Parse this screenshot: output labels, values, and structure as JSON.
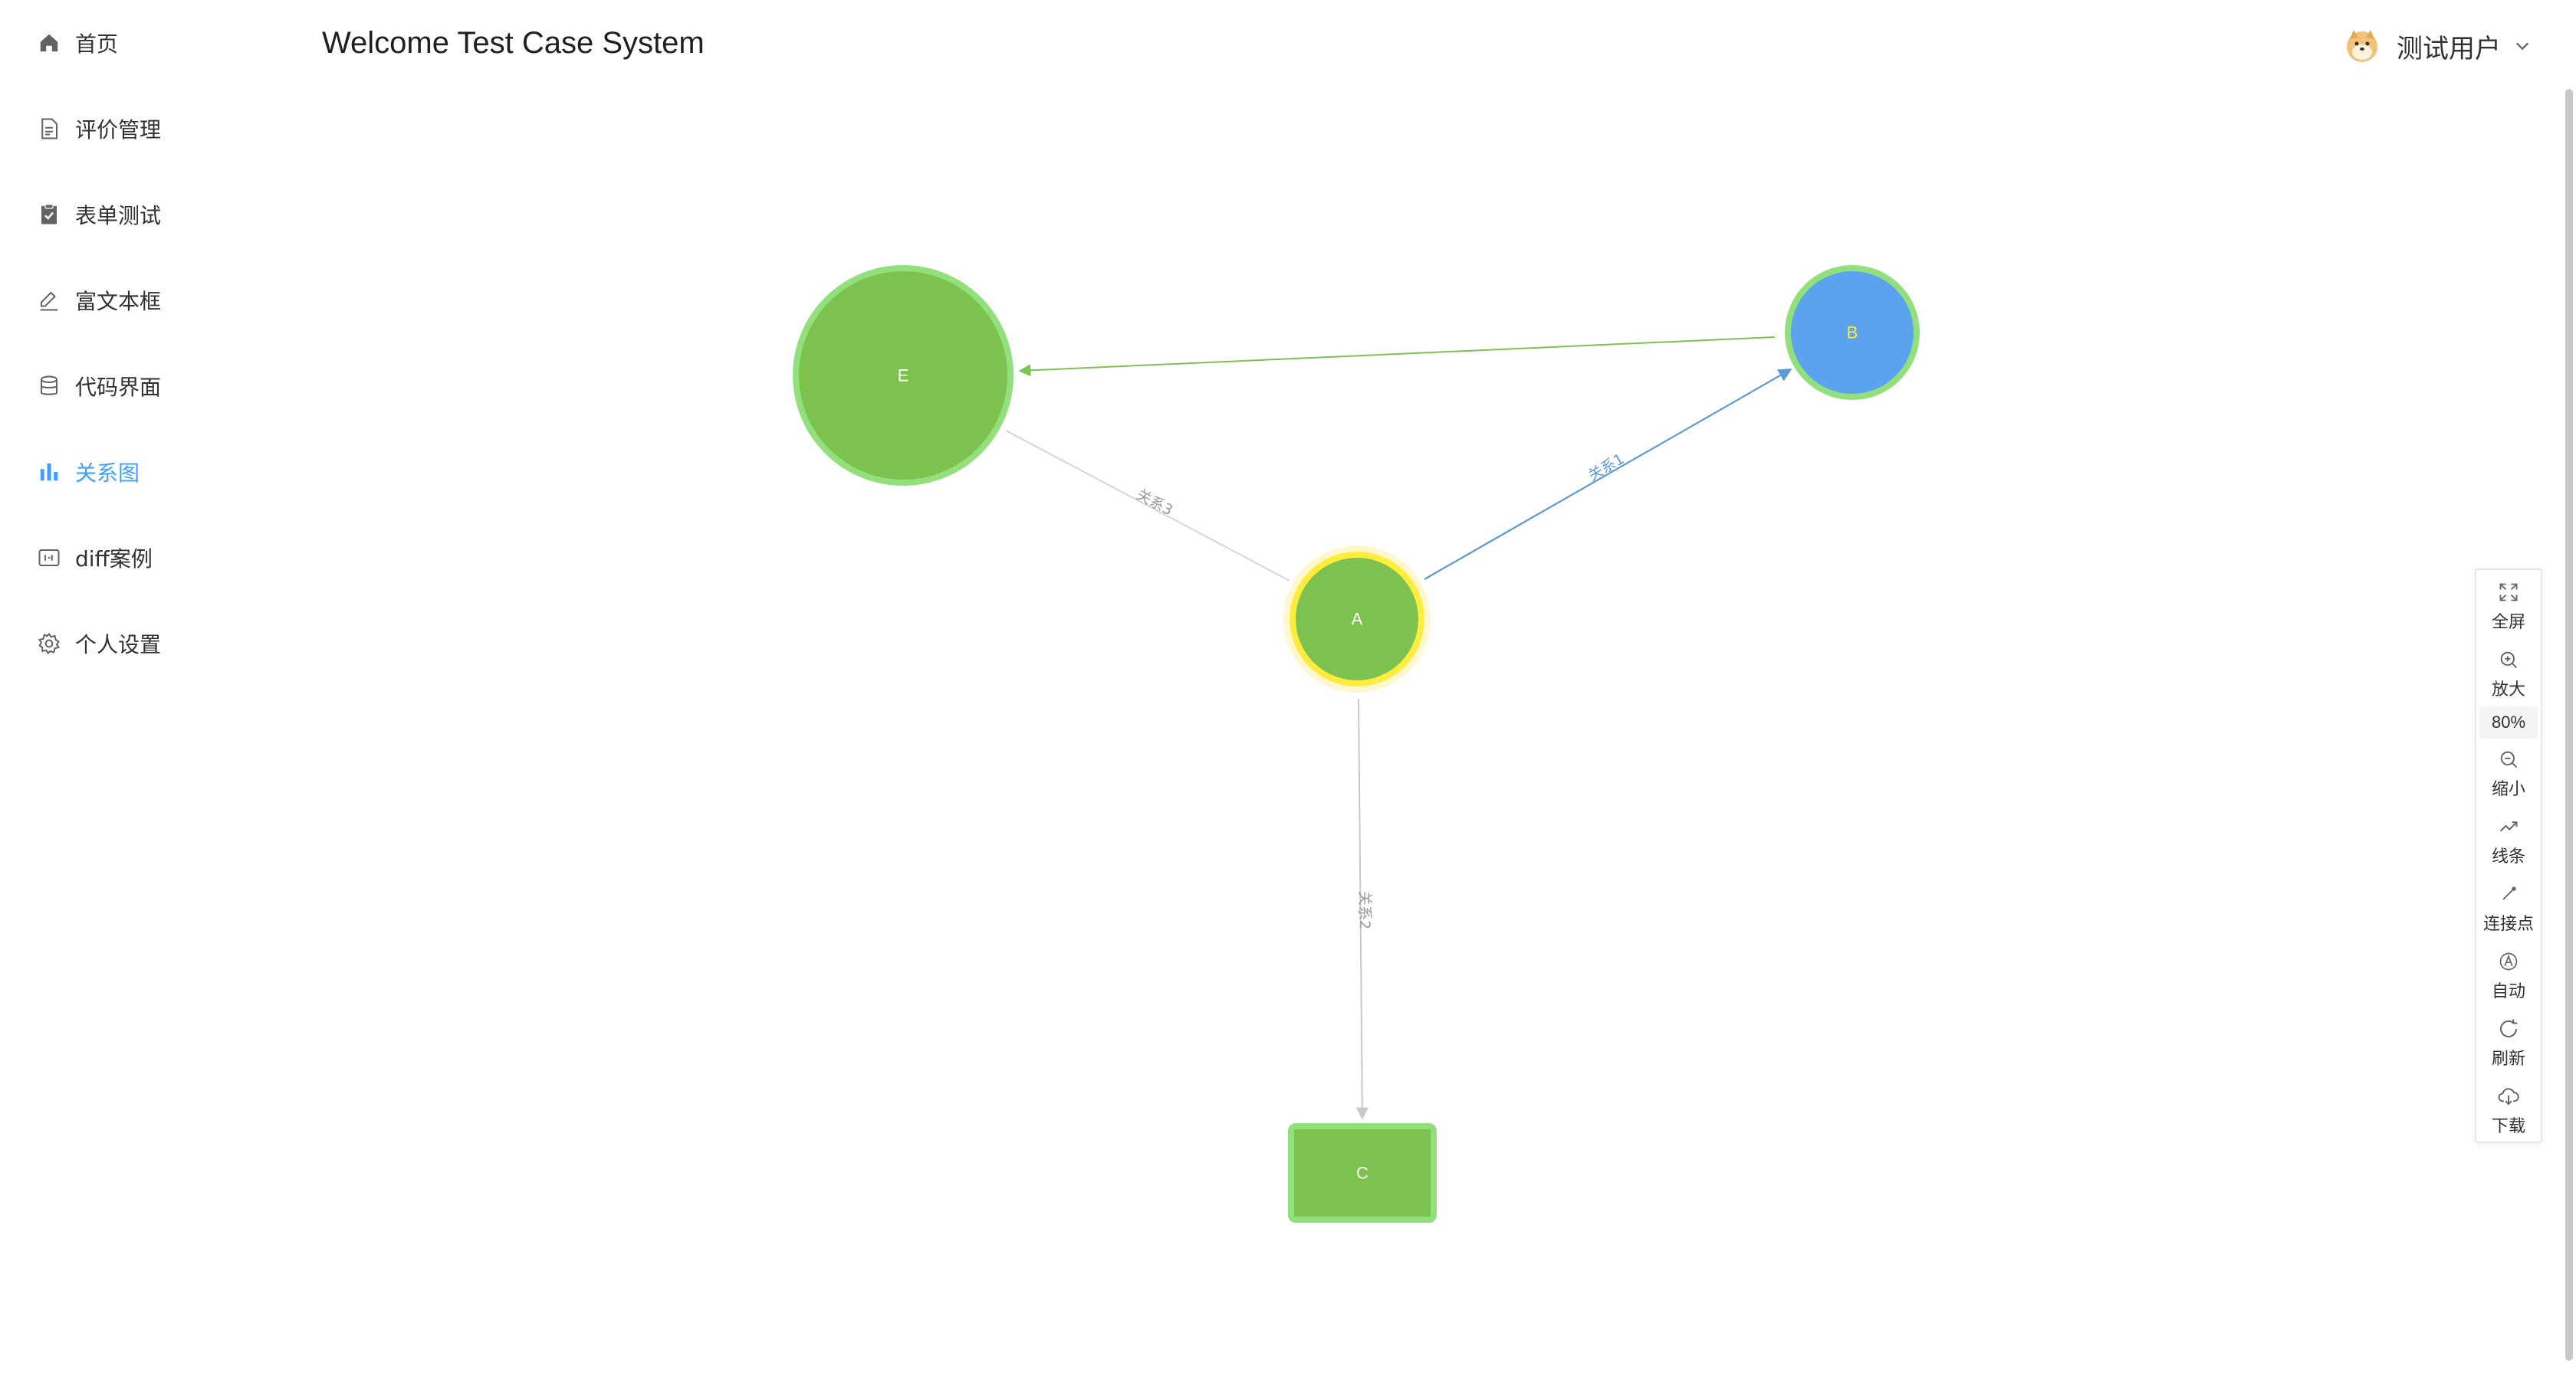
{
  "header": {
    "title": "Welcome Test Case System",
    "user_name": "测试用户"
  },
  "sidebar": {
    "items": [
      {
        "label": "首页",
        "icon": "home-icon"
      },
      {
        "label": "评价管理",
        "icon": "document-icon"
      },
      {
        "label": "表单测试",
        "icon": "clipboard-check-icon"
      },
      {
        "label": "富文本框",
        "icon": "edit-pen-icon"
      },
      {
        "label": "代码界面",
        "icon": "database-icon"
      },
      {
        "label": "关系图",
        "icon": "bar-chart-icon"
      },
      {
        "label": "diff案例",
        "icon": "diff-icon"
      },
      {
        "label": "个人设置",
        "icon": "gear-icon"
      }
    ],
    "active_index": 5,
    "active_color": "#409eff"
  },
  "graph": {
    "nodes": [
      {
        "id": "A",
        "label": "A",
        "shape": "circle",
        "fill": "#7dc14f",
        "border": "#ffec3d"
      },
      {
        "id": "B",
        "label": "B",
        "shape": "circle",
        "fill": "#5ba3ee",
        "border": "#92e07c"
      },
      {
        "id": "C",
        "label": "C",
        "shape": "rect",
        "fill": "#7dc14f",
        "border": "#92e07c"
      },
      {
        "id": "E",
        "label": "E",
        "shape": "circle",
        "fill": "#7dc14f",
        "border": "#92e07c"
      }
    ],
    "edges": [
      {
        "from": "A",
        "to": "B",
        "label": "关系1",
        "color": "#5b9bd5"
      },
      {
        "from": "A",
        "to": "C",
        "label": "关系2",
        "color": "#c8c8c8"
      },
      {
        "from": "A",
        "to": "E",
        "label": "关系3",
        "color": "#d0d0d0"
      },
      {
        "from": "B",
        "to": "E",
        "label": "",
        "color": "#7dc14f"
      }
    ]
  },
  "toolbar": {
    "fullscreen": "全屏",
    "zoom_in": "放大",
    "zoom_level": "80%",
    "zoom_out": "缩小",
    "lines": "线条",
    "connect_points": "连接点",
    "auto": "自动",
    "refresh": "刷新",
    "download": "下载"
  }
}
